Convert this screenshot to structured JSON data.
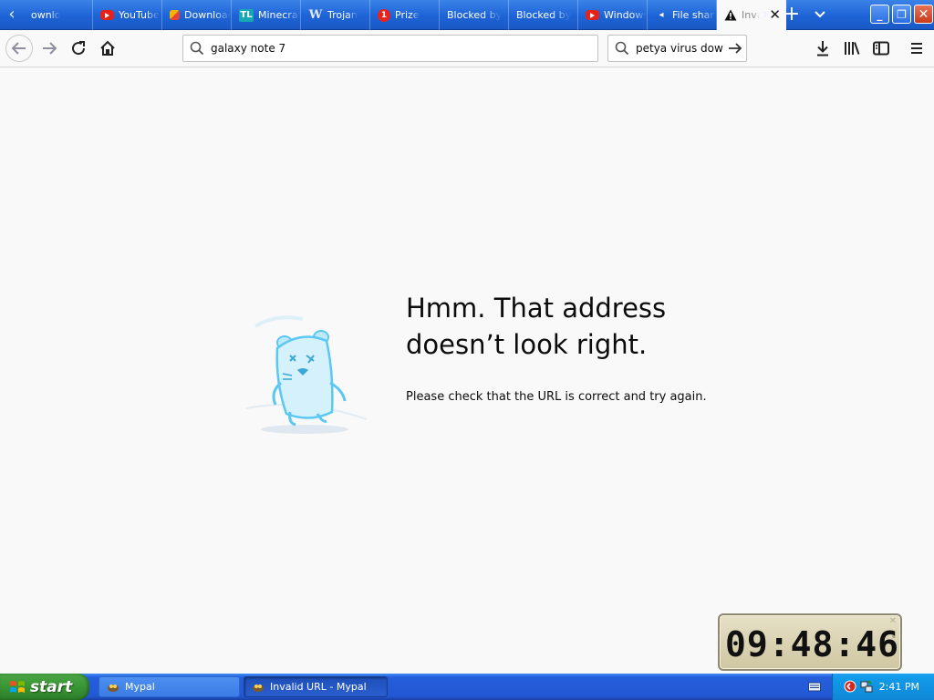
{
  "browser": {
    "tabs": [
      {
        "label": "ownlo",
        "favicon": "none"
      },
      {
        "label": "YouTube",
        "favicon": "youtube-icon"
      },
      {
        "label": "Download",
        "favicon": "generic-icon"
      },
      {
        "label": "Minecraft",
        "favicon": "tl-icon",
        "favicon_text": "TL"
      },
      {
        "label": "Trojan",
        "favicon": "w-icon",
        "favicon_text": "W"
      },
      {
        "label": "Prize",
        "favicon": "number-badge-icon",
        "favicon_text": "1"
      },
      {
        "label": "Blocked by",
        "favicon": "none"
      },
      {
        "label": "Blocked by",
        "favicon": "none"
      },
      {
        "label": "Windows",
        "favicon": "youtube-icon"
      },
      {
        "label": "File sharing",
        "favicon": "file-share-icon"
      }
    ],
    "active_tab": {
      "label": "Invalid URL",
      "favicon": "warning-icon",
      "close_glyph": "✕"
    },
    "tabs_scroll_left": "‹",
    "tabs_scroll_right": "›",
    "new_tab_glyph": "+",
    "all_tabs_glyph": "⌄",
    "window_buttons": {
      "minimize": "_",
      "maximize": "❐",
      "close": "✕"
    },
    "url": "galaxy note 7",
    "search_query": "petya virus download"
  },
  "error_page": {
    "title_line1": "Hmm. That address",
    "title_line2": "doesn’t look right.",
    "description": "Please check that the URL is correct and try again."
  },
  "clock_widget": {
    "time": "09:48:46",
    "close_glyph": "✕"
  },
  "taskbar": {
    "start_label": "start",
    "tasks": [
      {
        "label": "Mypal",
        "active": false
      },
      {
        "label": "Invalid URL - Mypal",
        "active": true
      }
    ],
    "clock": "2:41 PM"
  },
  "colors": {
    "taskbar_blue": "#245edb",
    "start_green": "#3a9535",
    "tray_blue": "#119ae9",
    "tab_strip_blue": "#1d63d6",
    "page_background": "#f9f9fa"
  }
}
